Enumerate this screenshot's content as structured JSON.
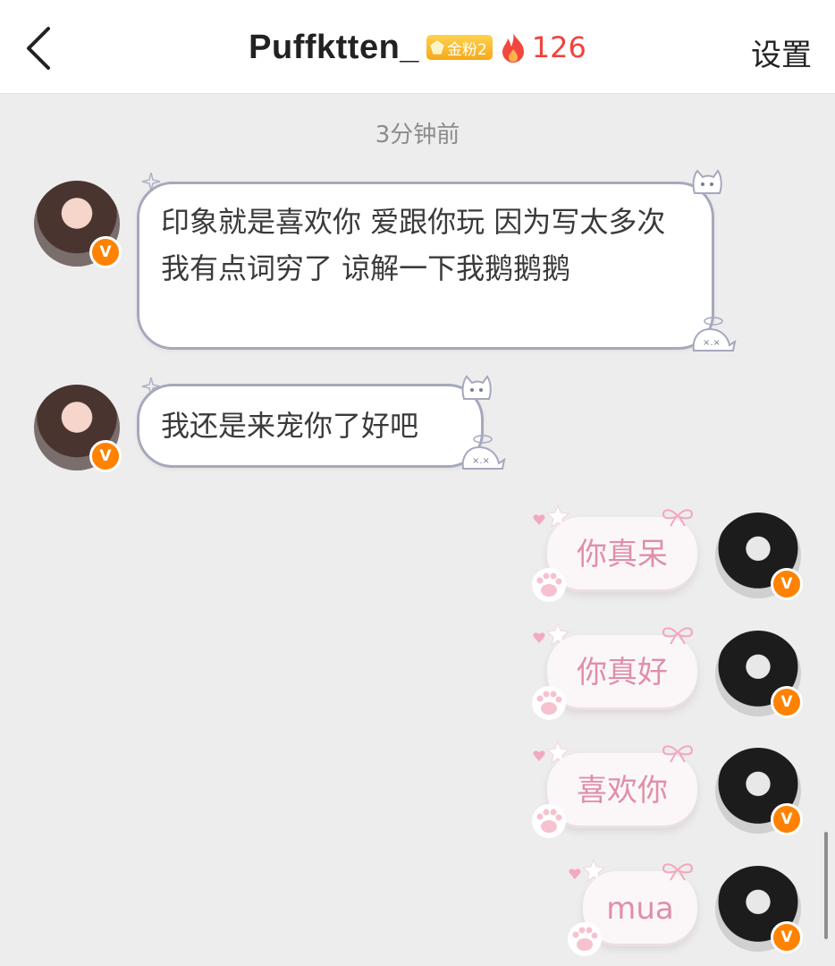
{
  "header": {
    "title": "Puffktten_",
    "fan_badge": "金粉2",
    "fire_count": "126",
    "settings_label": "设置"
  },
  "chat": {
    "timestamp": "3分钟前",
    "messages": [
      {
        "side": "left",
        "text": "印象就是喜欢你 爱跟你玩 因为写太多次 我有点词穷了 谅解一下我鹅鹅鹅"
      },
      {
        "side": "left",
        "text": "我还是来宠你了好吧"
      },
      {
        "side": "right",
        "text": "你真呆"
      },
      {
        "side": "right",
        "text": "你真好"
      },
      {
        "side": "right",
        "text": "喜欢你"
      },
      {
        "side": "right",
        "text": "mua"
      }
    ]
  },
  "colors": {
    "header_bg": "#ffffff",
    "chat_bg": "#ededed",
    "incoming_bubble_border": "#a6a8bd",
    "outgoing_text": "#e08fa8",
    "fire_count": "#f0433e",
    "verified_badge": "#ff8200",
    "fan_badge": "#f6a91a"
  },
  "icons": {
    "back": "chevron-left-icon",
    "fan_badge": "gem-icon",
    "fire": "flame-icon",
    "verified": "v-badge-icon",
    "bubble_deco": [
      "cat-face-icon",
      "sparkle-icon",
      "ghost-icon",
      "bow-icon",
      "paw-icon",
      "star-icon",
      "heart-icon"
    ]
  }
}
